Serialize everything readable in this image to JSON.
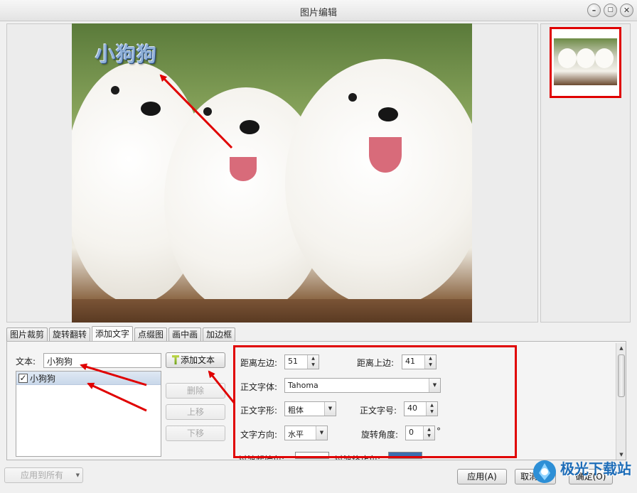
{
  "window": {
    "title": "图片编辑",
    "controls": [
      "minimize",
      "maximize",
      "close"
    ]
  },
  "preview": {
    "overlay_text": "小狗狗"
  },
  "tabs": [
    "图片裁剪",
    "旋转翻转",
    "添加文字",
    "点缀图",
    "画中画",
    "加边框"
  ],
  "active_tab": "添加文字",
  "text_panel": {
    "text_label": "文本:",
    "text_value": "小狗狗",
    "add_button": "添加文本",
    "list_items": [
      {
        "label": "小狗狗",
        "checked": true
      }
    ],
    "delete_button": "删除",
    "up_button": "上移",
    "down_button": "下移"
  },
  "properties": {
    "left_label": "距离左边:",
    "left_value": "51",
    "top_label": "距离上边:",
    "top_value": "41",
    "font_label": "正文字体:",
    "font_value": "Tahoma",
    "style_label": "正文字形:",
    "style_value": "粗体",
    "size_label": "正文字号:",
    "size_value": "40",
    "direction_label": "文字方向:",
    "direction_value": "水平",
    "rotation_label": "旋转角度:",
    "rotation_value": "0",
    "rotation_unit": "°",
    "gradient_start_label": "过渡起始色:",
    "gradient_end_label": "过渡终止色:",
    "gradient_end_color": "#3b6fb0"
  },
  "footer": {
    "apply_all": "应用到所有",
    "apply": "应用(A)",
    "cancel": "取消(C)",
    "ok": "确定(O)"
  },
  "watermark": {
    "text": "极光下载站"
  },
  "colors": {
    "highlight_red": "#e00000",
    "selection": "#c9d8ea"
  }
}
